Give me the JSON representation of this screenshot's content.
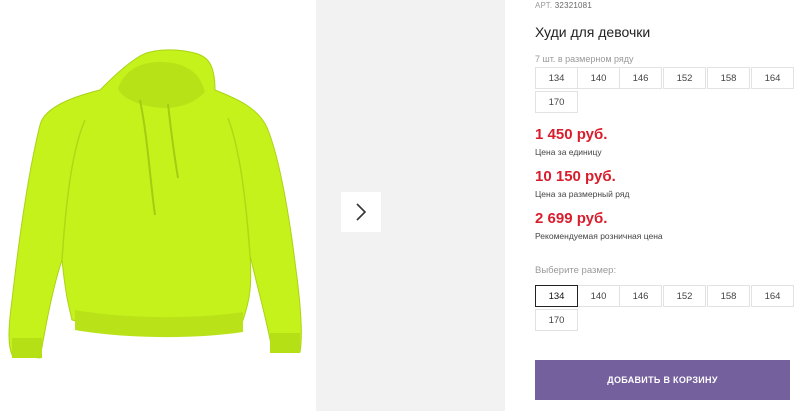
{
  "product": {
    "article_label": "АРТ.",
    "article_number": "32321081",
    "title": "Худи для девочки",
    "color": "#c6f21c"
  },
  "size_range": {
    "caption": "7 шт. в размерном ряду",
    "sizes": [
      "134",
      "140",
      "146",
      "152",
      "158",
      "164",
      "170"
    ]
  },
  "prices": {
    "unit_price": "1 450 руб.",
    "unit_label": "Цена за единицу",
    "range_price": "10 150 руб.",
    "range_label": "Цена за размерный ряд",
    "retail_price": "2 699 руб.",
    "retail_label": "Рекомендуемая розничная цена"
  },
  "size_select": {
    "caption": "Выберите размер:",
    "sizes": [
      "134",
      "140",
      "146",
      "152",
      "158",
      "164",
      "170"
    ],
    "selected": "134"
  },
  "gallery": {
    "next_icon": "chevron-right-icon"
  },
  "cart": {
    "add_label": "ДОБАВИТЬ В КОРЗИНУ",
    "button_color": "#75609e"
  },
  "colors": {
    "price": "#d81e2c",
    "gallery_bg": "#f2f2f2"
  }
}
